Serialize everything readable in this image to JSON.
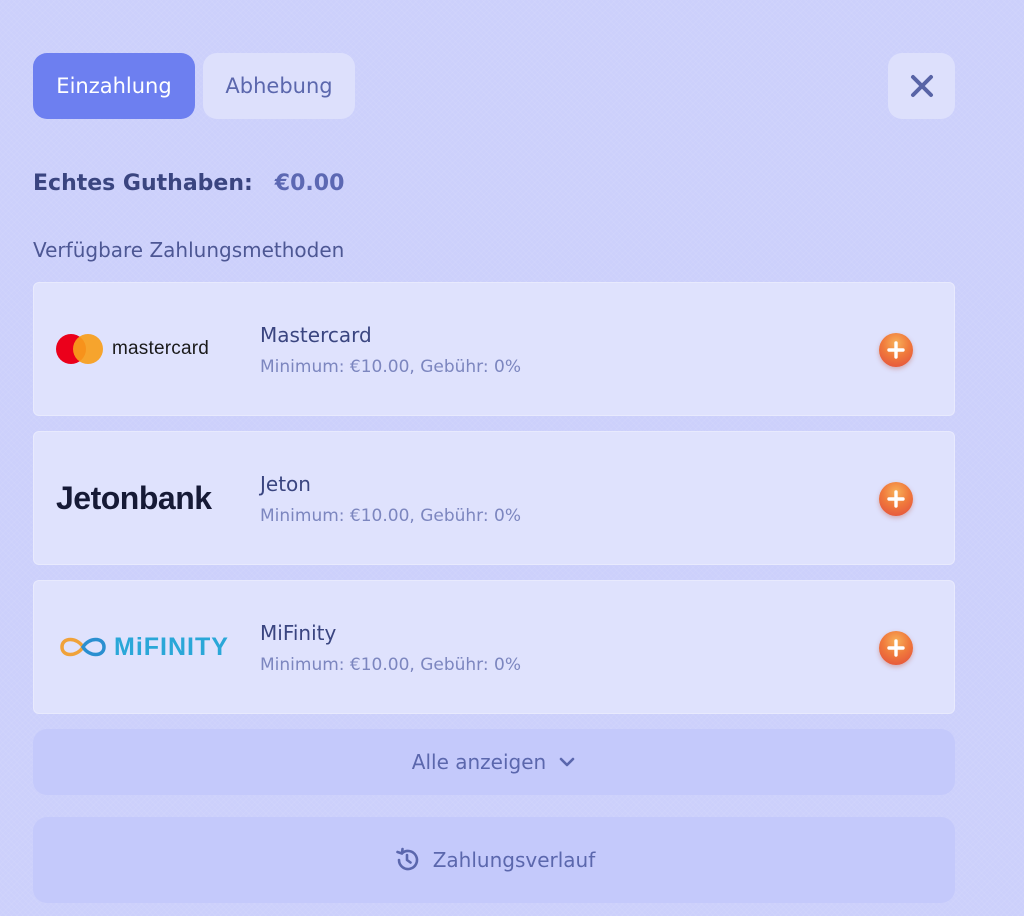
{
  "tabs": [
    {
      "label": "Einzahlung",
      "active": true
    },
    {
      "label": "Abhebung",
      "active": false
    }
  ],
  "close_icon": "close-icon",
  "balance": {
    "label": "Echtes Guthaben:",
    "value": "€0.00"
  },
  "methods_heading": "Verfügbare Zahlungsmethoden",
  "methods": [
    {
      "logo_text": "mastercard",
      "name": "Mastercard",
      "info": "Minimum: €10.00, Gebühr: 0%",
      "icon": "plus-icon"
    },
    {
      "logo_text": "Jetonbank",
      "name": "Jeton",
      "info": "Minimum: €10.00, Gebühr: 0%",
      "icon": "plus-icon"
    },
    {
      "logo_text": "MiFINITY",
      "name": "MiFinity",
      "info": "Minimum: €10.00, Gebühr: 0%",
      "icon": "plus-icon"
    }
  ],
  "show_all": {
    "label": "Alle anzeigen",
    "icon": "chevron-down-icon"
  },
  "history": {
    "label": "Zahlungsverlauf",
    "icon": "history-icon"
  },
  "colors": {
    "background": "#ccd0fb",
    "accent": "#6d7ff0",
    "card": "#dfe2fd",
    "add_button": "#f07a3c"
  }
}
